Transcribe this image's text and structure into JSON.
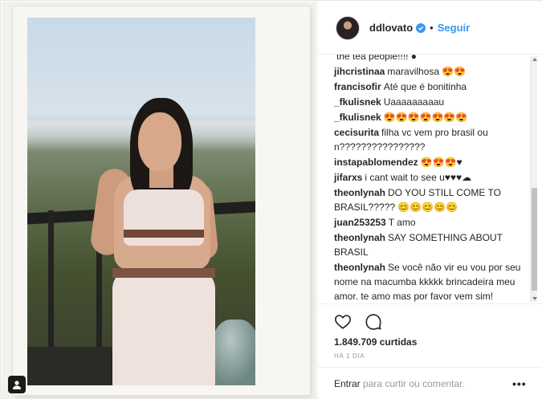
{
  "header": {
    "username": "ddlovato",
    "separator": "•",
    "follow_label": "Seguir"
  },
  "comments": [
    {
      "user": "",
      "text": "the tea people!!!! ●"
    },
    {
      "user": "jihcristinaa",
      "text": "maravilhosa 😍😍"
    },
    {
      "user": "francisofir",
      "text": "Até que é bonitinha"
    },
    {
      "user": "_fkulisnek",
      "text": "Uaaaaaaaaau"
    },
    {
      "user": "_fkulisnek",
      "text": "😍😍😍😍😍😍😍"
    },
    {
      "user": "cecisurita",
      "text": "filha vc vem pro brasil ou n????????????????"
    },
    {
      "user": "instapablomendez",
      "text": "😍😍😍♥"
    },
    {
      "user": "jifarxs",
      "text": "i cant wait to see u♥♥♥☁"
    },
    {
      "user": "theonlynah",
      "text": "DO YOU STILL COME TO BRASIL????? 😊😊😊😊😊"
    },
    {
      "user": "juan253253",
      "text": "T amo"
    },
    {
      "user": "theonlynah",
      "text": "SAY SOMETHING ABOUT BRASIL"
    },
    {
      "user": "theonlynah",
      "text": "Se você não vir eu vou por seu nome na macumba kkkkk brincadeira meu amor. te amo mas por favor vem sim!"
    }
  ],
  "post": {
    "likes": "1.849.709 curtidas",
    "time": "HÁ 1 DIA"
  },
  "add_comment": {
    "login_link": "Entrar",
    "rest": " para curtir ou comentar.",
    "more": "•••"
  },
  "colors": {
    "link_blue": "#3897f0",
    "text": "#262626",
    "muted": "#999999"
  },
  "icons": {
    "like": "heart-icon",
    "comment": "comment-bubble-icon",
    "tag": "user-tag-icon",
    "verified": "verified-badge-icon"
  }
}
